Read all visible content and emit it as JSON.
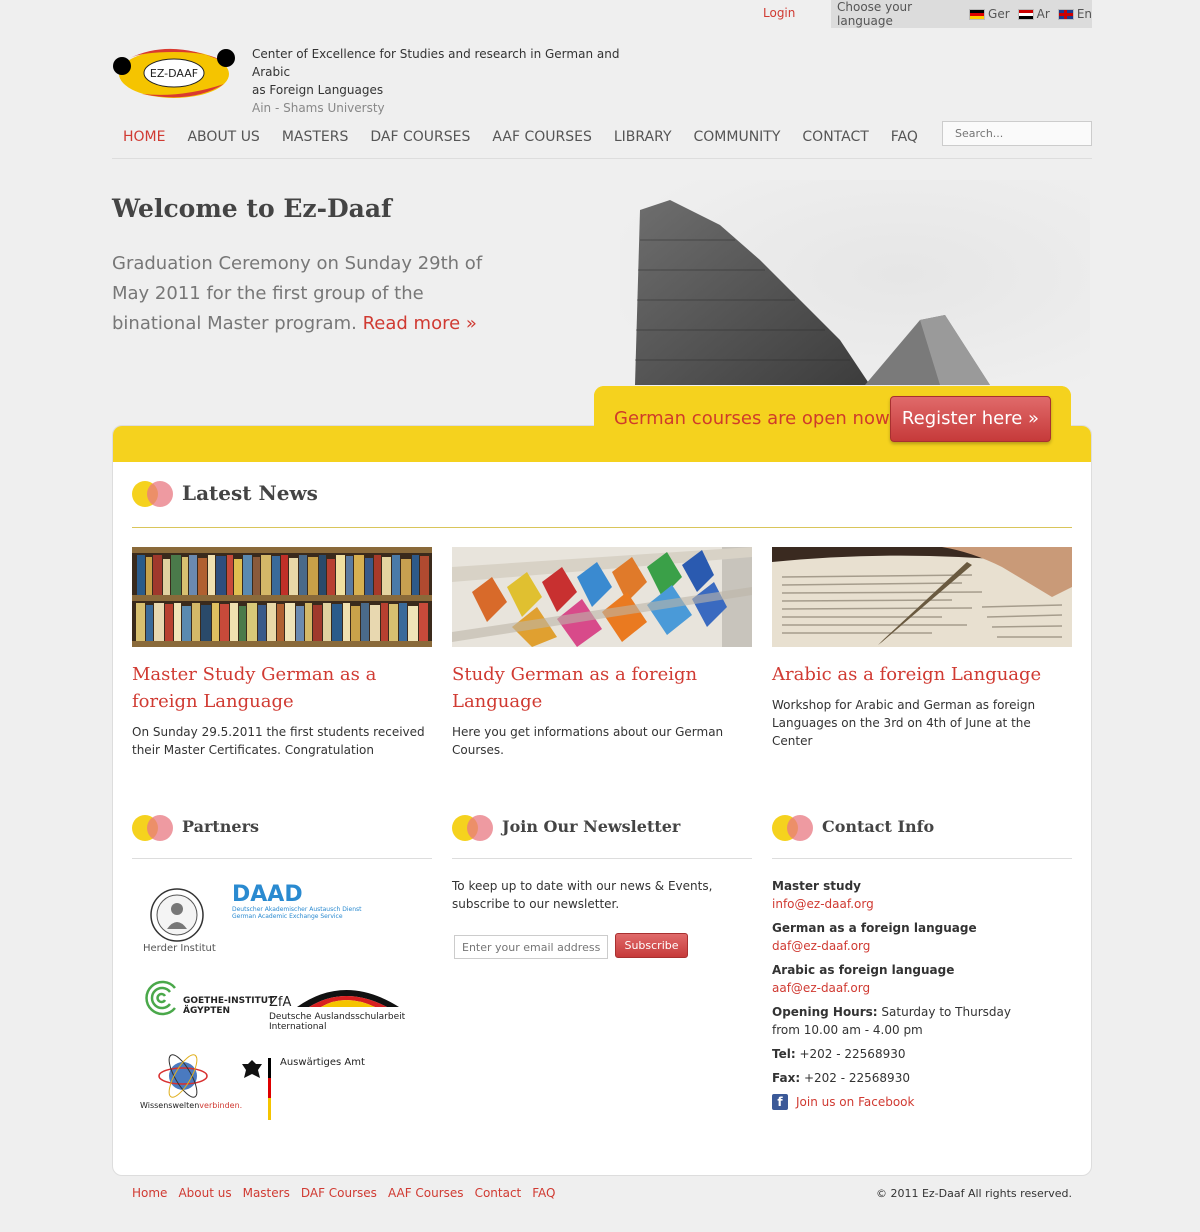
{
  "topbar": {
    "login": "Login",
    "language_label": "Choose your language",
    "languages": [
      "Ger",
      "Ar",
      "En"
    ]
  },
  "logo": {
    "mark": "EZ-DAAF",
    "line1": "Center of Excellence for Studies and research in German and Arabic",
    "line2": "as Foreign Languages",
    "sub": "Ain - Shams Universty"
  },
  "nav": [
    "HOME",
    "ABOUT US",
    "MASTERS",
    "DAF COURSES",
    "AAF COURSES",
    "LIBRARY",
    "COMMUNITY",
    "CONTACT",
    "FAQ"
  ],
  "search": {
    "placeholder": "Search..."
  },
  "hero": {
    "title": "Welcome to Ez-Daaf",
    "text": "Graduation Ceremony on Sunday 29th of May 2011 for the first group of the binational Master program.",
    "link": "Read more »"
  },
  "banner": {
    "text": "German courses are open now",
    "button": "Register here »"
  },
  "news": {
    "title": "Latest News",
    "items": [
      {
        "title": "Master Study German as a foreign Language",
        "text": "On Sunday 29.5.2011 the first students received their Master Certificates. Congratulation"
      },
      {
        "title": "Study German as a foreign Language",
        "text": "Here you get informations about our German Courses."
      },
      {
        "title": "Arabic as a foreign Language",
        "text": "Workshop for Arabic and German as foreign Languages on the 3rd on 4th of June at the Center"
      }
    ]
  },
  "partners": {
    "title": "Partners",
    "herder": "Herder Institut",
    "daad": "DAAD",
    "daad_sub1": "Deutscher Akademischer Austausch Dienst",
    "daad_sub2": "German Academic Exchange Service",
    "goethe1": "GOETHE-INSTITUT",
    "goethe2": "ÄGYPTEN",
    "zfa": "ZfA",
    "zfa_sub1": "Deutsche Auslandsschularbeit",
    "zfa_sub2": "International",
    "wiss1": "Wissenswelten",
    "wiss2": "verbinden.",
    "aa": "Auswärtiges Amt"
  },
  "newsletter": {
    "title": "Join Our Newsletter",
    "text": "To keep up to date with our news & Events, subscribe to our newsletter.",
    "placeholder": "Enter your email address ...",
    "button": "Subscribe"
  },
  "contact": {
    "title": "Contact Info",
    "master_label": "Master study",
    "master_email": "info@ez-daaf.org",
    "german_label": "German as a foreign language",
    "german_email": "daf@ez-daaf.org",
    "arabic_label": "Arabic as foreign language",
    "arabic_email": "aaf@ez-daaf.org",
    "hours_label": "Opening Hours:",
    "hours_value": "Saturday to Thursday",
    "hours_time": "from 10.00 am - 4.00 pm",
    "tel_label": "Tel:",
    "tel_value": "+202 - 22568930",
    "fax_label": "Fax:",
    "fax_value": "+202 - 22568930",
    "facebook": "Join us on Facebook"
  },
  "footer": {
    "links": [
      "Home",
      "About us",
      "Masters",
      "DAF Courses",
      "AAF Courses",
      "Contact",
      "FAQ"
    ],
    "copyright": "© 2011 Ez-Daaf All rights reserved."
  },
  "colors": {
    "accent": "#d03a32",
    "yellow": "#f5d21e",
    "pink": "#e87882"
  }
}
